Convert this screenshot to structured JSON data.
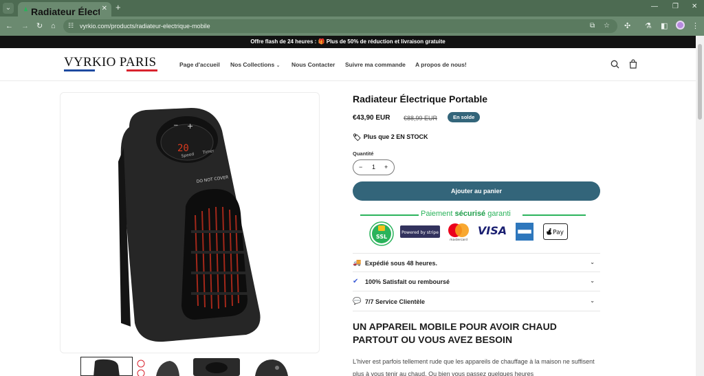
{
  "browser": {
    "tab_title": "Radiateur Électrique Portable",
    "tab_close": "✕",
    "new_tab": "+",
    "url": "vyrkio.com/products/radiateur-electrique-mobile"
  },
  "announcement": "Offre flash de 24 heures : 🎁 Plus de 50% de réduction et livraison gratuite",
  "header": {
    "logo_text": "VYRKIO PARIS",
    "logo_colors": [
      "#1d4aa0",
      "#ffffff",
      "#d9232e"
    ],
    "nav": [
      {
        "label": "Page d'accueil"
      },
      {
        "label": "Nos Collections"
      },
      {
        "label": "Nous Contacter"
      },
      {
        "label": "Suivre ma commande"
      },
      {
        "label": "A propos de nous!"
      }
    ]
  },
  "product": {
    "title": "Radiateur Électrique Portable",
    "price": "€43,90 EUR",
    "old_price": "€88,99 EUR",
    "sale_badge": "En solde",
    "stock": "Plus que 2 EN STOCK",
    "quantity_label": "Quantité",
    "quantity": "1",
    "qty_minus": "−",
    "qty_plus": "+",
    "add_to_cart": "Ajouter au panier",
    "device_display": "20",
    "device_speed": "Speed",
    "device_timer": "Timer",
    "device_warning": "DO NOT COVER",
    "device_minus": "−",
    "device_plus": "+"
  },
  "payment": {
    "label_pre": "Paiement ",
    "label_bold": "sécurisé",
    "label_post": " garanti",
    "ssl": "SSL",
    "stripe": "Powered by stripe",
    "mastercard": "mastercard",
    "visa": "VISA",
    "applepay": "Pay",
    "accent": "#2ab35b"
  },
  "accordion": [
    {
      "icon": "truck-icon",
      "label": "Expédié sous 48 heures."
    },
    {
      "icon": "check-icon",
      "label": "100% Satisfait ou remboursé"
    },
    {
      "icon": "chat-icon",
      "label": "7/7 Service Clientèle"
    }
  ],
  "description": {
    "title": "UN APPAREIL MOBILE POUR AVOIR CHAUD PARTOUT OU VOUS AVEZ BESOIN",
    "text": "L'hiver est parfois tellement rude que les appareils de chauffage à la maison ne suffisent plus à vous tenir au chaud. Ou bien vous passez quelques heures"
  },
  "colors": {
    "brand": "#33657a",
    "browser_frame": "#4d6b52"
  }
}
